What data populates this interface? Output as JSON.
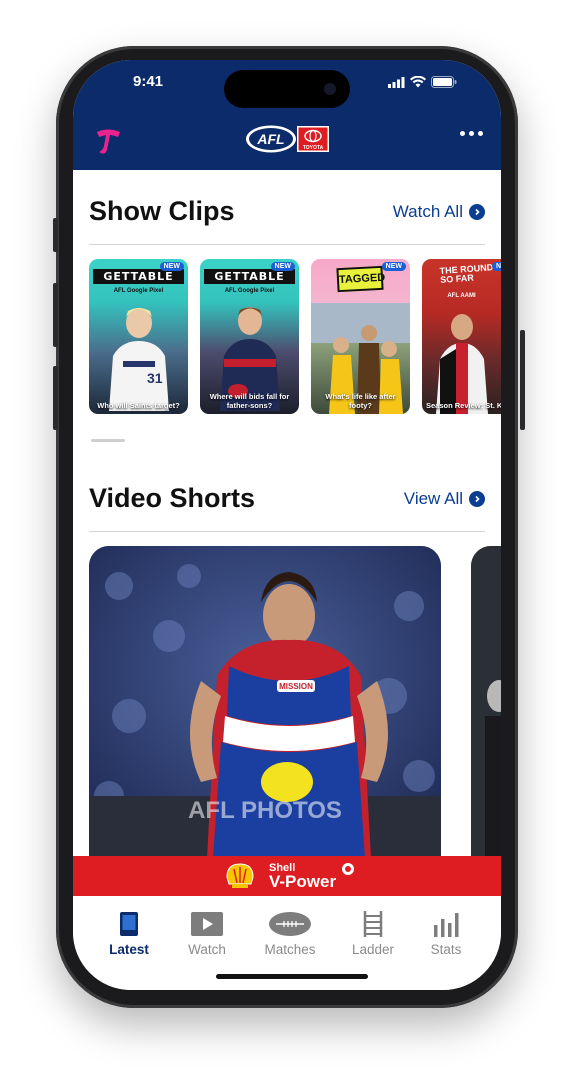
{
  "status_bar": {
    "time": "9:41"
  },
  "header": {
    "brand_left": "Telstra",
    "logo_text": "AFL",
    "sponsor_text": "TOYOTA"
  },
  "show_clips": {
    "title": "Show Clips",
    "view_all": "Watch All",
    "items": [
      {
        "banner": "GETTABLE",
        "sub": "AFL  Google Pixel",
        "badge": "NEW",
        "caption": "Who will Saints target?"
      },
      {
        "banner": "GETTABLE",
        "sub": "AFL  Google Pixel",
        "badge": "NEW",
        "caption": "Where will bids fall for father-sons?"
      },
      {
        "banner": "TAGGED",
        "sub": "",
        "badge": "NEW",
        "caption": "What's life like after footy?"
      },
      {
        "banner": "THE ROUND SO FAR",
        "sub": "AFL  AAMI",
        "badge": "N",
        "caption": "Season Review: St. Ki"
      }
    ]
  },
  "video_shorts": {
    "title": "Video Shorts",
    "view_all": "View All",
    "watermark": "AFL PHOTOS",
    "jersey_text": "MISSION"
  },
  "ad": {
    "line1": "Shell",
    "line2": "V-Power"
  },
  "tabs": [
    {
      "label": "Latest",
      "icon": "latest-icon",
      "active": true
    },
    {
      "label": "Watch",
      "icon": "watch-icon",
      "active": false
    },
    {
      "label": "Matches",
      "icon": "football-icon",
      "active": false
    },
    {
      "label": "Ladder",
      "icon": "ladder-icon",
      "active": false
    },
    {
      "label": "Stats",
      "icon": "bar-chart-icon",
      "active": false
    }
  ],
  "colors": {
    "header": "#0b2b6b",
    "accent": "#0b3d91",
    "shell_red": "#dd1d21"
  }
}
